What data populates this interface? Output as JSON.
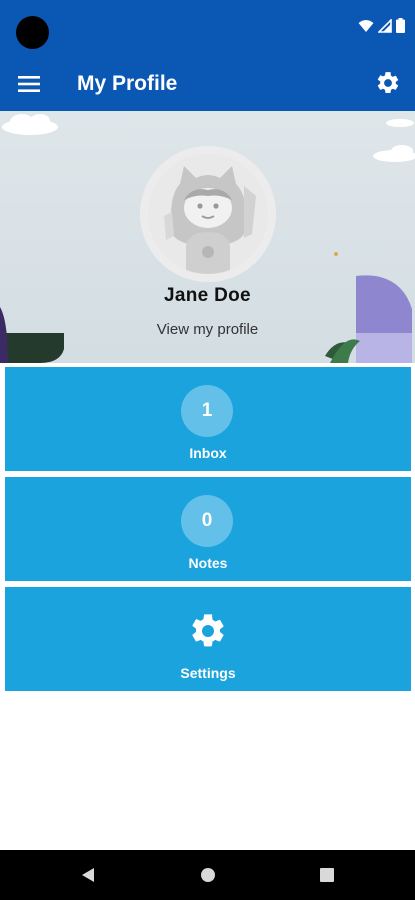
{
  "app_bar": {
    "title": "My Profile"
  },
  "profile": {
    "name": "Jane Doe",
    "view_link": "View my profile"
  },
  "tiles": [
    {
      "count": "1",
      "label": "Inbox"
    },
    {
      "count": "0",
      "label": "Notes"
    },
    {
      "label": "Settings"
    }
  ],
  "icons": {
    "menu": "hamburger-menu-icon",
    "settings": "gear-icon",
    "wifi": "wifi-icon",
    "signal": "cell-signal-icon",
    "battery": "battery-icon",
    "back": "back-triangle-icon",
    "home": "home-circle-icon",
    "recents": "recents-square-icon"
  },
  "colors": {
    "app_bar": "#0b57b4",
    "tile": "#1aa3dd",
    "nav_bar": "#000000"
  }
}
